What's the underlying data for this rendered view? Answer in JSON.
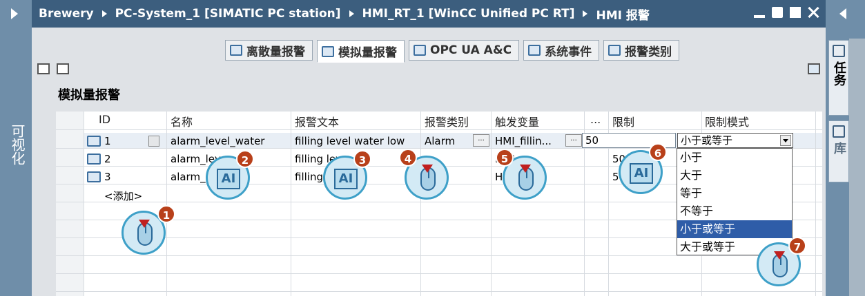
{
  "left_panel": {
    "label": "可视化"
  },
  "title": {
    "crumbs": [
      "Brewery",
      "PC-System_1 [SIMATIC PC station]",
      "HMI_RT_1 [WinCC Unified PC RT]",
      "HMI 报警"
    ]
  },
  "right_panel": {
    "tasks_label": "任务",
    "library_label": "库"
  },
  "tabs": [
    {
      "label": "离散量报警"
    },
    {
      "label": "模拟量报警"
    },
    {
      "label": "OPC UA A&C"
    },
    {
      "label": "系统事件"
    },
    {
      "label": "报警类别"
    }
  ],
  "section_title": "模拟量报警",
  "table": {
    "headers": [
      "ID",
      "名称",
      "报警文本",
      "报警类别",
      "触发变量",
      "...",
      "限制",
      "限制模式"
    ],
    "rows": [
      {
        "id": "1",
        "name": "alarm_level_water",
        "text": "filling level water low",
        "class": "Alarm",
        "trigger": "HMI_fillin...",
        "limit": "50",
        "mode": "小于或等于"
      },
      {
        "id": "2",
        "name": "alarm_lev",
        "text": "filling leve",
        "class": "",
        "trigger": "HMI_",
        "limit": "50",
        "mode": ""
      },
      {
        "id": "3",
        "name": "alarm_lev",
        "text": "filling leve",
        "text_tail": "ow",
        "class": "A",
        "trigger": "HMI_t",
        "limit": "50",
        "mode": ""
      }
    ],
    "add_label": "<添加>",
    "spinner_dots": "...",
    "dropdown_options": [
      "小于",
      "大于",
      "等于",
      "不等于",
      "小于或等于",
      "大于或等于"
    ],
    "selected_option": "小于或等于"
  },
  "callouts": [
    "1",
    "2",
    "3",
    "4",
    "5",
    "6",
    "7"
  ],
  "icon_glyphs": {
    "ai": "AI"
  },
  "colors": {
    "titlebar": "#3c5e7e",
    "side": "#6f8ea9",
    "selection": "#2f5da8",
    "callout_number": "#b8401a",
    "callout_ring": "#3ea0c8"
  }
}
